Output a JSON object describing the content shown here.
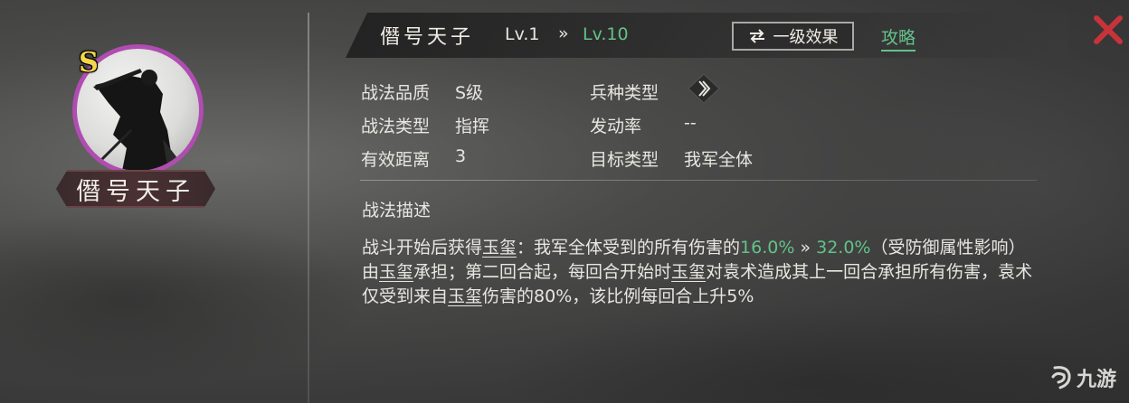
{
  "skill": {
    "name": "僭号天子",
    "grade": "S",
    "level_from": "Lv.1",
    "level_arrow": "»",
    "level_to": "Lv.10"
  },
  "header": {
    "effect_button_icon": "swap-arrows-icon",
    "effect_button_label": "一级效果",
    "guide_label": "攻略"
  },
  "attributes": {
    "quality_label": "战法品质",
    "quality_value": "S级",
    "troop_label": "兵种类型",
    "troop_icon": "troop-type-icon",
    "type_label": "战法类型",
    "type_value": "指挥",
    "rate_label": "发动率",
    "rate_value": "--",
    "range_label": "有效距离",
    "range_value": "3",
    "target_label": "目标类型",
    "target_value": "我军全体"
  },
  "description": {
    "title": "战法描述",
    "seg1": "战斗开始后获得",
    "jade1": "玉玺",
    "seg2": "：我军全体受到的所有伤害的",
    "pct_from": "16.0%",
    "arrow": " » ",
    "pct_to": "32.0%",
    "seg3": "（受防御属性影响）由",
    "jade2": "玉玺",
    "seg4": "承担；第二回合起，每回合开始时",
    "jade3": "玉玺",
    "seg5": "对袁术造成其上一回合承担所有伤害，袁术仅受到来自",
    "jade4": "玉玺",
    "seg6": "伤害的80%，该比例每回合上升5%"
  },
  "watermark": {
    "text": "九游"
  },
  "colors": {
    "accent_green": "#63c28a",
    "grade_gold": "#f3d74a",
    "portrait_ring": "#b04cb2",
    "close_red": "#c8333a"
  }
}
